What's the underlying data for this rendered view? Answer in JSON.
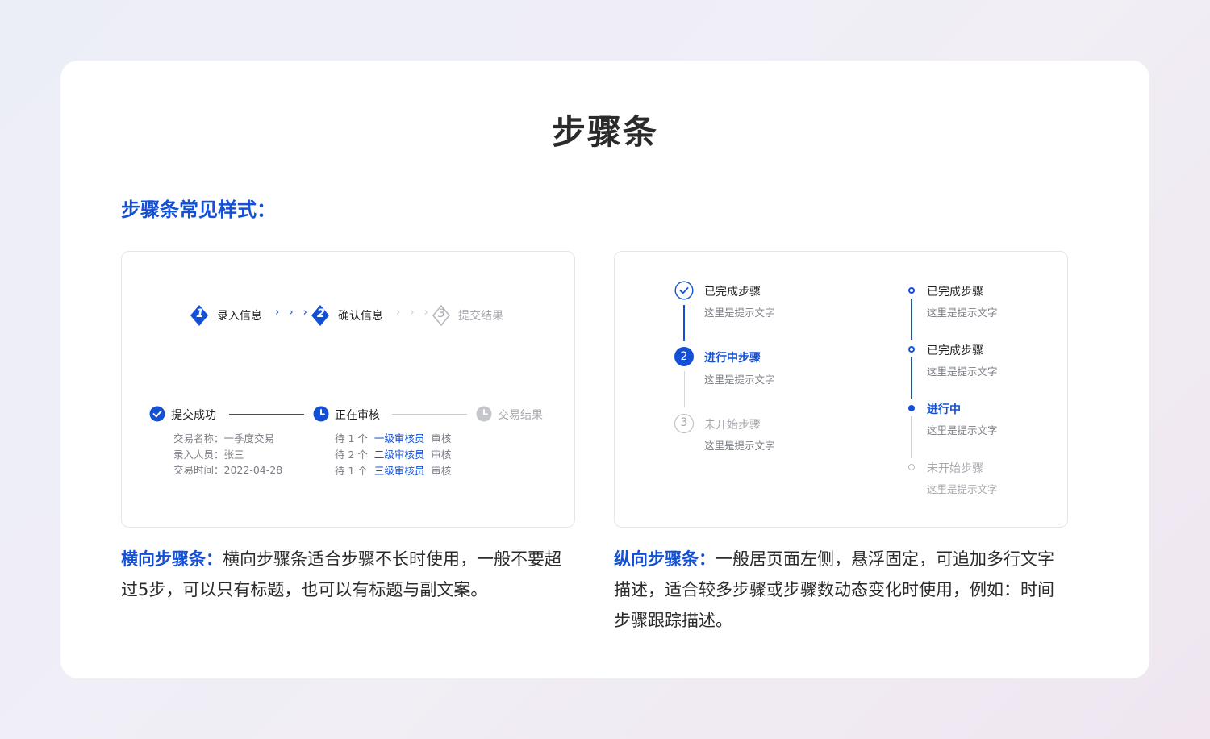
{
  "page": {
    "title": "步骤条",
    "section_heading": "步骤条常见样式："
  },
  "horizontal_simple": {
    "steps": [
      {
        "number": "1",
        "label": "录入信息",
        "state": "done"
      },
      {
        "number": "2",
        "label": "确认信息",
        "state": "active"
      },
      {
        "number": "3",
        "label": "提交结果",
        "state": "pending"
      }
    ],
    "separator": "› › ›"
  },
  "horizontal_detail": {
    "steps": [
      {
        "label": "提交成功",
        "icon": "check-icon",
        "state": "done",
        "details": [
          "交易名称：一季度交易",
          "录入人员：张三",
          "交易时间：2022-04-28"
        ]
      },
      {
        "label": "正在审核",
        "icon": "clock-icon",
        "state": "active",
        "details": [
          {
            "prefix": "待 1 个",
            "link": "一级审核员",
            "suffix": "审核"
          },
          {
            "prefix": "待 2 个",
            "link": "二级审核员",
            "suffix": "审核"
          },
          {
            "prefix": "待 1 个",
            "link": "三级审核员",
            "suffix": "审核"
          }
        ]
      },
      {
        "label": "交易结果",
        "icon": "clock-icon",
        "state": "pending"
      }
    ]
  },
  "vertical_numbered": {
    "steps": [
      {
        "number": "",
        "label": "已完成步骤",
        "desc": "这里是提示文字",
        "state": "done"
      },
      {
        "number": "2",
        "label": "进行中步骤",
        "desc": "这里是提示文字",
        "state": "active"
      },
      {
        "number": "3",
        "label": "未开始步骤",
        "desc": "这里是提示文字",
        "state": "pending"
      }
    ]
  },
  "vertical_dot": {
    "steps": [
      {
        "label": "已完成步骤",
        "desc": "这里是提示文字",
        "state": "done"
      },
      {
        "label": "已完成步骤",
        "desc": "这里是提示文字",
        "state": "done"
      },
      {
        "label": "进行中",
        "desc": "这里是提示文字",
        "state": "active"
      },
      {
        "label": "未开始步骤",
        "desc": "这里是提示文字",
        "state": "pending"
      }
    ]
  },
  "captions": {
    "horizontal": {
      "heading": "横向步骤条：",
      "body": "横向步骤条适合步骤不长时使用，一般不要超过5步，可以只有标题，也可以有标题与副文案。"
    },
    "vertical": {
      "heading": "纵向步骤条：",
      "body": "一般居页面左侧，悬浮固定，可追加多行文字描述，适合较多步骤或步骤数动态变化时使用，例如：时间步骤跟踪描述。"
    }
  },
  "colors": {
    "accent": "#1450d6",
    "text": "#222222",
    "muted": "#a6a8ad",
    "secondary": "#7b7e85"
  }
}
